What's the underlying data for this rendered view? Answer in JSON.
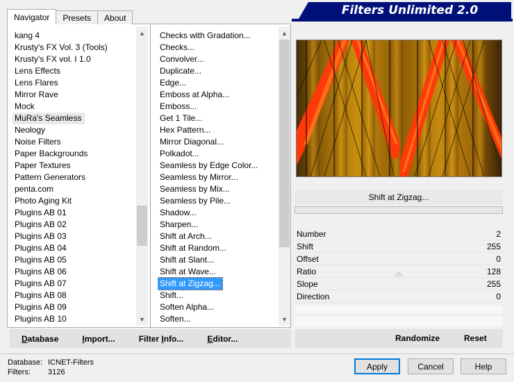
{
  "window": {
    "title": "Filters Unlimited 2.0",
    "accent_color": "#00107a"
  },
  "tabs": [
    {
      "label": "Navigator",
      "active": true
    },
    {
      "label": "Presets",
      "active": false
    },
    {
      "label": "About",
      "active": false
    }
  ],
  "categories": {
    "selected": "MuRa's Seamless",
    "items": [
      "kang 4",
      "Krusty's FX Vol. 3 (Tools)",
      "Krusty's FX vol. I 1.0",
      "Lens Effects",
      "Lens Flares",
      "Mirror Rave",
      "Mock",
      "MuRa's Seamless",
      "Neology",
      "Noise Filters",
      "Paper Backgrounds",
      "Paper Textures",
      "Pattern Generators",
      "penta.com",
      "Photo Aging Kit",
      "Plugins AB 01",
      "Plugins AB 02",
      "Plugins AB 03",
      "Plugins AB 04",
      "Plugins AB 05",
      "Plugins AB 06",
      "Plugins AB 07",
      "Plugins AB 08",
      "Plugins AB 09",
      "Plugins AB 10"
    ]
  },
  "filters": {
    "selected": "Shift at Zigzag...",
    "items": [
      "Checks with Gradation...",
      "Checks...",
      "Convolver...",
      "Duplicate...",
      "Edge...",
      "Emboss at Alpha...",
      "Emboss...",
      "Get 1 Tile...",
      "Hex Pattern...",
      "Mirror Diagonal...",
      "Polkadot...",
      "Seamless by Edge Color...",
      "Seamless by Mirror...",
      "Seamless by Mix...",
      "Seamless by Pile...",
      "Shadow...",
      "Sharpen...",
      "Shift at Arch...",
      "Shift at Random...",
      "Shift at Slant...",
      "Shift at Wave...",
      "Shift at Zigzag...",
      "Shift...",
      "Soften Alpha...",
      "Soften..."
    ]
  },
  "filter_name": "Shift at Zigzag...",
  "parameters": [
    {
      "name": "Number",
      "value": "2"
    },
    {
      "name": "Shift",
      "value": "255"
    },
    {
      "name": "Offset",
      "value": "0"
    },
    {
      "name": "Ratio",
      "value": "128"
    },
    {
      "name": "Slope",
      "value": "255"
    },
    {
      "name": "Direction",
      "value": "0"
    }
  ],
  "bottom_bar": {
    "database": {
      "underlined": "D",
      "rest": "atabase"
    },
    "import": {
      "underlined": "I",
      "rest": "mport..."
    },
    "filter_info": {
      "before": "Filter ",
      "underlined": "I",
      "rest": "nfo..."
    },
    "editor": {
      "underlined": "E",
      "rest": "ditor..."
    },
    "randomize": "Randomize",
    "reset": "Reset"
  },
  "info": {
    "database_label": "Database:",
    "database_value": "ICNET-Filters",
    "filters_label": "Filters:",
    "filters_value": "3126"
  },
  "buttons": {
    "apply": "Apply",
    "cancel": "Cancel",
    "help": "Help"
  }
}
